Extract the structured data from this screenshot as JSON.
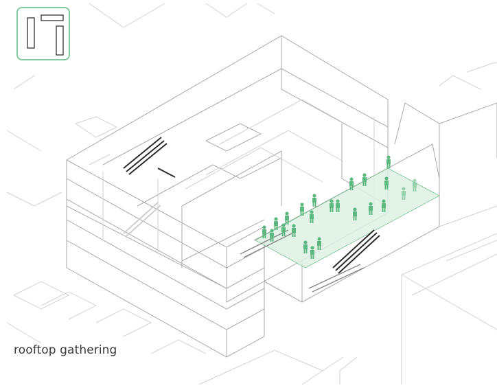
{
  "caption": "rooftop gathering",
  "badge_icon": "building-plan-icon",
  "colors": {
    "line": "#a9a9a9",
    "light_line": "#d2d2d2",
    "accent": "#5cb87e",
    "roof_fill": "#dff1e5",
    "stair": "#2b2b2b"
  }
}
